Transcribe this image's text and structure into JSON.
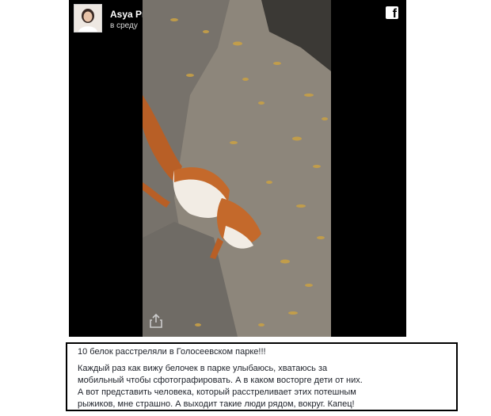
{
  "post": {
    "author_name": "Asya Pratsyukova",
    "post_time": "в среду",
    "brand_icon": "facebook-icon",
    "share_icon": "share-icon"
  },
  "caption": {
    "title": "10 белок расстреляли в Голосеевском парке!!!",
    "body": "Каждый раз как вижу белочек в парке улыбаюсь, хватаюсь за\nмобильный чтобы сфотографировать. А в каком восторге дети от них.\nА вот представить человека, который расстреливает этих потешным\nрыжиков, мне страшно. А выходит такие люди рядом, вокруг. Капец!"
  },
  "colors": {
    "video_background": "#000000",
    "ground": "#8a8275",
    "leaves": "#c9a24a",
    "squirrel_fur": "#c76a2a"
  }
}
